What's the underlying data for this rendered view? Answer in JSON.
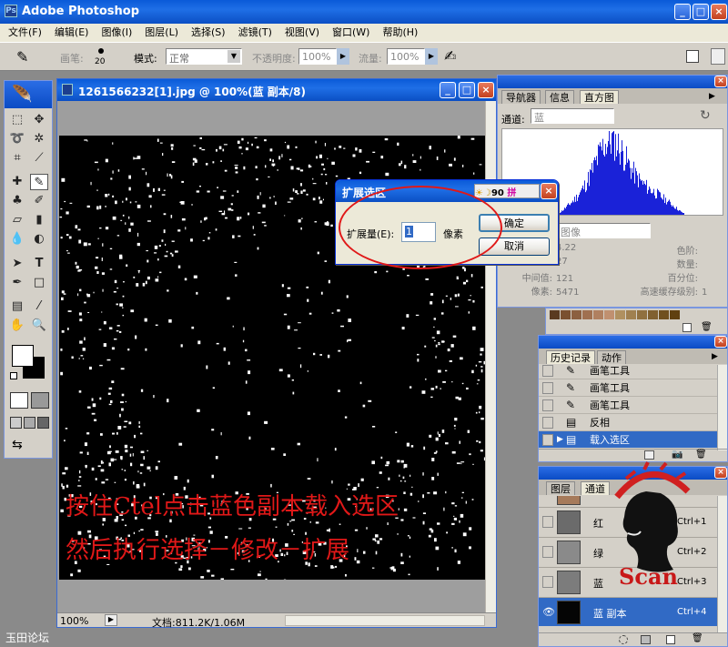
{
  "app": {
    "title": "Adobe Photoshop"
  },
  "menu": [
    "文件(F)",
    "编辑(E)",
    "图像(I)",
    "图层(L)",
    "选择(S)",
    "滤镜(T)",
    "视图(V)",
    "窗口(W)",
    "帮助(H)"
  ],
  "options_bar": {
    "brush_label": "画笔:",
    "brush_size": "20",
    "mode_label": "模式:",
    "mode_value": "正常",
    "opacity_label": "不透明度:",
    "opacity_value": "100%",
    "flow_label": "流量:",
    "flow_value": "100%"
  },
  "document": {
    "title": "1261566232[1].jpg @ 100%(蓝 副本/8)",
    "zoom": "100%",
    "doc_info": "文档:811.2K/1.06M"
  },
  "overlay": {
    "line1": "按住Ctel点击蓝色副本载入选区",
    "line2": "然后执行选择－修改－扩展"
  },
  "dialog": {
    "title": "扩展选区",
    "label": "扩展量(E):",
    "value": "1",
    "unit": "像素",
    "ok": "确定",
    "cancel": "取消",
    "ime_text": "90",
    "ime_text2": "拼"
  },
  "navigator": {
    "tabs": [
      "导航器",
      "信息",
      "直方图"
    ],
    "channel_label": "通道:",
    "channel_value": "蓝",
    "source_value": "图像",
    "left_stats": [
      {
        "label": "",
        "value": "4.22"
      },
      {
        "label": "",
        "value": "27"
      },
      {
        "label": "中间值:",
        "value": "121"
      },
      {
        "label": "像素:",
        "value": "5471"
      }
    ],
    "right_stats": [
      {
        "label": "色阶:",
        "value": ""
      },
      {
        "label": "数量:",
        "value": ""
      },
      {
        "label": "百分位:",
        "value": ""
      },
      {
        "label": "高速缓存级别:",
        "value": "1"
      }
    ]
  },
  "history": {
    "tabs": [
      "历史记录",
      "动作"
    ],
    "items": [
      "画笔工具",
      "画笔工具",
      "画笔工具",
      "反相",
      "载入选区"
    ]
  },
  "layers": {
    "tabs": [
      "图层",
      "通道"
    ],
    "channels": [
      {
        "name": "红",
        "shortcut": "Ctrl+1"
      },
      {
        "name": "绿",
        "shortcut": "Ctrl+2"
      },
      {
        "name": "蓝",
        "shortcut": "Ctrl+3"
      },
      {
        "name": "蓝 副本",
        "shortcut": "Ctrl+4"
      }
    ]
  },
  "watermark": {
    "text": "Scan"
  },
  "footer": {
    "text": "玉田论坛"
  },
  "colors": {
    "xp_blue": "#1f6fe6",
    "overlay_red": "#e01818",
    "histogram_blue": "#1a22d8",
    "selection_blue": "#316ac5"
  }
}
